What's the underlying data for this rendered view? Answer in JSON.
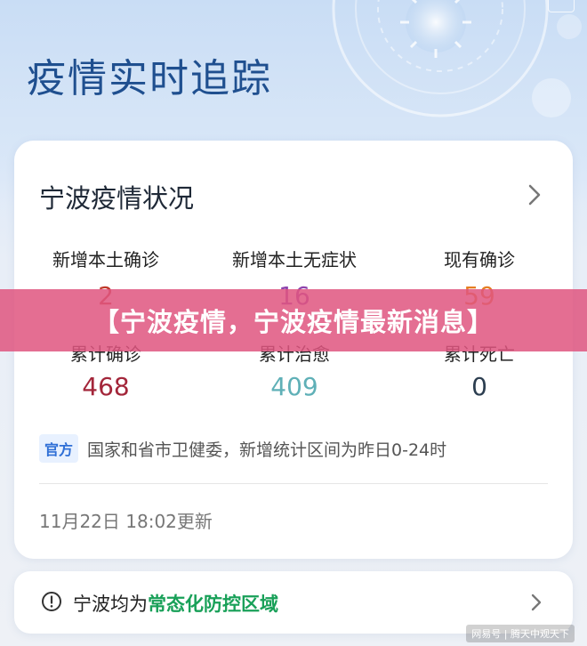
{
  "header": {
    "title": "疫情实时追踪"
  },
  "card": {
    "title": "宁波疫情状况",
    "stats_row1": [
      {
        "label": "新增本土确诊",
        "value": "2",
        "color": "#c0392b"
      },
      {
        "label": "新增本土无症状",
        "value": "16",
        "color": "#8e44ad"
      },
      {
        "label": "现有确诊",
        "value": "59",
        "color": "#e67e22"
      }
    ],
    "stats_row2": [
      {
        "label": "累计确诊",
        "value": "468",
        "color": "#a3263a"
      },
      {
        "label": "累计治愈",
        "value": "409",
        "color": "#5fb0b7"
      },
      {
        "label": "累计死亡",
        "value": "0",
        "color": "#2c3e50"
      }
    ],
    "source_badge": "官方",
    "source_text": "国家和省市卫健委，新增统计区间为昨日0-24时",
    "update_time": "11月22日 18:02更新"
  },
  "zone": {
    "prefix": "宁波均为",
    "highlight": "常态化防控区域",
    "highlight_color": "#18a058"
  },
  "banner": {
    "text": "【宁波疫情，宁波疫情最新消息】",
    "color": "#df5680"
  },
  "watermark": {
    "text": "网易号 | 腾天中观天下"
  },
  "icons": {
    "chevron": "chevron-right-icon",
    "info": "exclamation-circle-icon",
    "virus": "virus-icon"
  }
}
